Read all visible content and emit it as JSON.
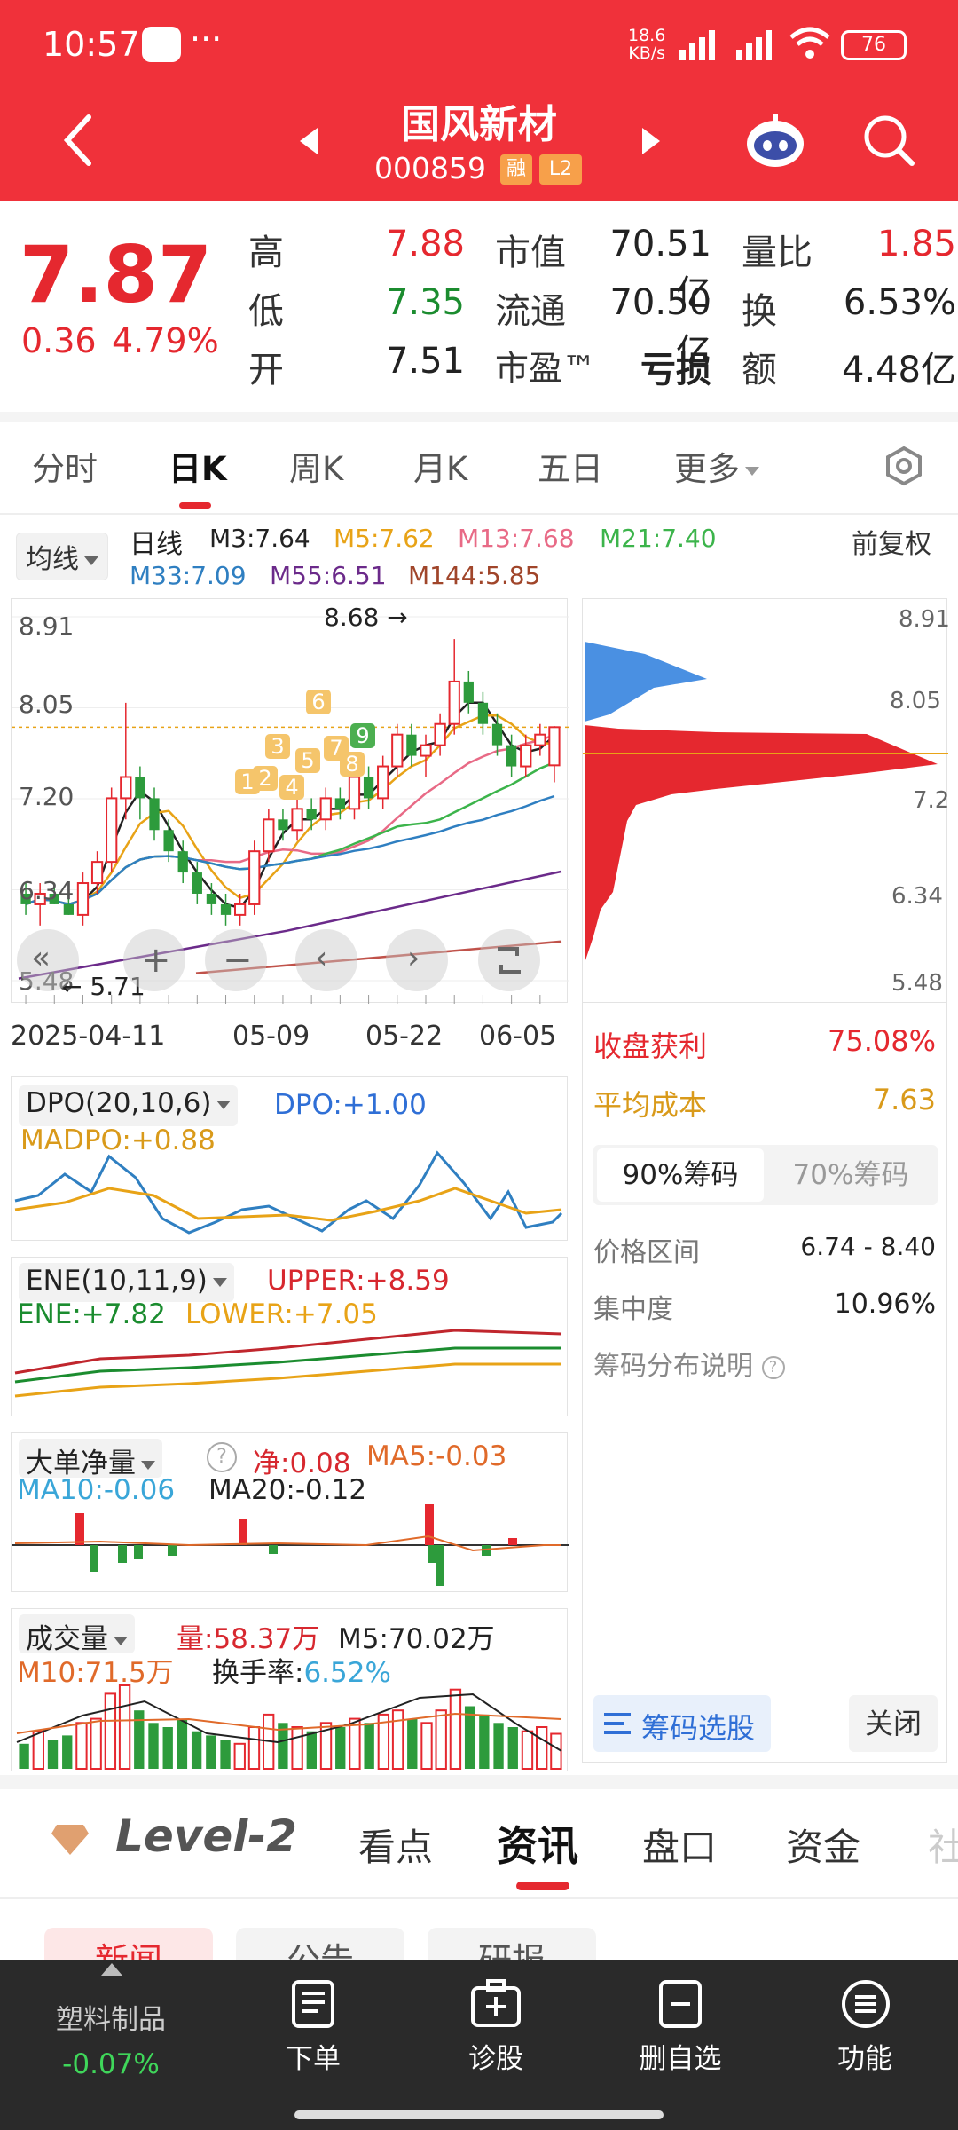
{
  "status": {
    "time": "10:57",
    "more": "···",
    "speed_top": "18.6",
    "speed_unit": "KB/s",
    "battery": "76"
  },
  "header": {
    "stock_name": "国风新材",
    "stock_code": "000859",
    "badge_rong": "融",
    "badge_l2": "L2"
  },
  "quote": {
    "price": "7.87",
    "change": "0.36",
    "change_pct": "4.79%",
    "high_label": "高",
    "high": "7.88",
    "low_label": "低",
    "low": "7.35",
    "open_label": "开",
    "open": "7.51",
    "mcap_label": "市值",
    "mcap": "70.51亿",
    "float_label": "流通",
    "float": "70.50亿",
    "pe_label": "市盈™",
    "pe": "亏损",
    "vr_label": "量比",
    "vr": "1.85",
    "turn_label": "换",
    "turn": "6.53%",
    "amt_label": "额",
    "amt": "4.48亿"
  },
  "tabs": {
    "t1": "分时",
    "t2": "日K",
    "t3": "周K",
    "t4": "月K",
    "t5": "五日",
    "t6": "更多"
  },
  "ma_bar": {
    "selector": "均线",
    "kind": "日线",
    "m3": "M3:7.64",
    "m5": "M5:7.62",
    "m13": "M13:7.68",
    "m21": "M21:7.40",
    "m33": "M33:7.09",
    "m55": "M55:6.51",
    "m144": "M144:5.85",
    "adjust": "前复权"
  },
  "kchart": {
    "y_labels": [
      "8.91",
      "8.05",
      "7.20",
      "6.34",
      "5.48"
    ],
    "high_mark": "8.68",
    "low_mark": "5.71",
    "dates": [
      "2025-04-11",
      "05-09",
      "05-22",
      "06-05"
    ],
    "bubbles": [
      "1",
      "2",
      "3",
      "4",
      "5",
      "6",
      "7",
      "8",
      "9"
    ]
  },
  "chart_data": {
    "type": "candlestick",
    "ylim": [
      5.48,
      8.91
    ],
    "x_labels": [
      "2025-04-11",
      "05-09",
      "05-22",
      "06-05"
    ],
    "ohlc": [
      [
        6.3,
        6.4,
        6.1,
        6.2
      ],
      [
        6.2,
        6.4,
        6.0,
        6.3
      ],
      [
        6.3,
        6.4,
        6.2,
        6.2
      ],
      [
        6.2,
        6.3,
        6.1,
        6.1
      ],
      [
        6.1,
        6.5,
        6.0,
        6.4
      ],
      [
        6.4,
        6.7,
        6.3,
        6.6
      ],
      [
        6.6,
        7.3,
        6.5,
        7.2
      ],
      [
        7.2,
        8.1,
        7.0,
        7.4
      ],
      [
        7.4,
        7.5,
        7.0,
        7.2
      ],
      [
        7.2,
        7.3,
        6.8,
        6.9
      ],
      [
        6.9,
        7.0,
        6.6,
        6.7
      ],
      [
        6.7,
        6.8,
        6.4,
        6.5
      ],
      [
        6.5,
        6.6,
        6.2,
        6.3
      ],
      [
        6.3,
        6.4,
        6.1,
        6.2
      ],
      [
        6.2,
        6.3,
        6.0,
        6.1
      ],
      [
        6.1,
        6.3,
        6.0,
        6.2
      ],
      [
        6.2,
        6.8,
        6.1,
        6.7
      ],
      [
        6.7,
        7.1,
        6.6,
        7.0
      ],
      [
        7.0,
        7.1,
        6.8,
        6.9
      ],
      [
        6.9,
        7.2,
        6.8,
        7.1
      ],
      [
        7.1,
        7.2,
        6.9,
        7.0
      ],
      [
        7.0,
        7.3,
        6.9,
        7.2
      ],
      [
        7.2,
        7.3,
        7.0,
        7.1
      ],
      [
        7.1,
        7.5,
        7.0,
        7.4
      ],
      [
        7.4,
        7.5,
        7.1,
        7.2
      ],
      [
        7.2,
        7.6,
        7.1,
        7.5
      ],
      [
        7.5,
        7.9,
        7.4,
        7.8
      ],
      [
        7.8,
        7.9,
        7.5,
        7.6
      ],
      [
        7.6,
        7.8,
        7.4,
        7.7
      ],
      [
        7.7,
        8.0,
        7.6,
        7.9
      ],
      [
        7.9,
        8.7,
        7.8,
        8.3
      ],
      [
        8.3,
        8.4,
        8.0,
        8.1
      ],
      [
        8.1,
        8.2,
        7.8,
        7.9
      ],
      [
        7.9,
        8.0,
        7.6,
        7.7
      ],
      [
        7.7,
        7.8,
        7.4,
        7.5
      ],
      [
        7.5,
        7.8,
        7.4,
        7.7
      ],
      [
        7.7,
        7.9,
        7.6,
        7.8
      ],
      [
        7.51,
        7.88,
        7.35,
        7.87
      ]
    ],
    "series_ma": {
      "m3": 7.64,
      "m5": 7.62,
      "m13": 7.68,
      "m21": 7.4,
      "m33": 7.09,
      "m55": 6.51,
      "m144": 5.85
    }
  },
  "chips": {
    "y_labels": [
      "8.91",
      "8.05",
      "7.2",
      "6.34",
      "5.48"
    ],
    "profit_label": "收盘获利",
    "profit": "75.08%",
    "cost_label": "平均成本",
    "cost": "7.63",
    "tab90": "90%筹码",
    "tab70": "70%筹码",
    "range_label": "价格区间",
    "range": "6.74 - 8.40",
    "conc_label": "集中度",
    "conc": "10.96%",
    "explain": "筹码分布说明",
    "pick_btn": "筹码选股",
    "close_btn": "关闭"
  },
  "dpo": {
    "name": "DPO(20,10,6)",
    "dpo": "DPO:+1.00",
    "madpo": "MADPO:+0.88"
  },
  "ene": {
    "name": "ENE(10,11,9)",
    "upper": "UPPER:+8.59",
    "ene": "ENE:+7.82",
    "lower": "LOWER:+7.05"
  },
  "bigorder": {
    "name": "大单净量",
    "net": "净:0.08",
    "ma5": "MA5:-0.03",
    "ma10": "MA10:-0.06",
    "ma20": "MA20:-0.12"
  },
  "volume": {
    "name": "成交量",
    "vol": "量:58.37万",
    "m5": "M5:70.02万",
    "m10": "M10:71.5万",
    "turnover_label": "换手率:",
    "turnover": "6.52%"
  },
  "news_tabs": {
    "level2": "Level-2",
    "kandian": "看点",
    "zixun": "资讯",
    "pankou": "盘口",
    "zijin": "资金",
    "more": "社"
  },
  "sub_tabs": {
    "news": "新闻",
    "notice": "公告",
    "report": "研报"
  },
  "bottom": {
    "sector": "塑料制品",
    "sector_chg": "-0.07%",
    "order": "下单",
    "diagnose": "诊股",
    "del_fav": "删自选",
    "func": "功能"
  }
}
